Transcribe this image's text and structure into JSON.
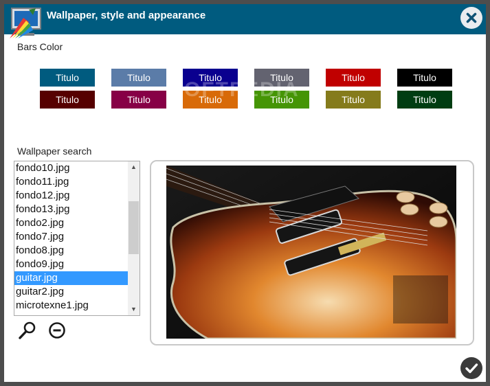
{
  "window": {
    "title": "Wallpaper, style and appearance"
  },
  "bars_color": {
    "label": "Bars Color",
    "swatches": [
      {
        "label": "Titulo",
        "color": "#005b7f"
      },
      {
        "label": "Titulo",
        "color": "#5b7ca8"
      },
      {
        "label": "Titulo",
        "color": "#0a008f"
      },
      {
        "label": "Titulo",
        "color": "#636370"
      },
      {
        "label": "Titulo",
        "color": "#c00000"
      },
      {
        "label": "Titulo",
        "color": "#000000"
      },
      {
        "label": "Titulo",
        "color": "#560000"
      },
      {
        "label": "Titulo",
        "color": "#870046"
      },
      {
        "label": "Titulo",
        "color": "#d86a08"
      },
      {
        "label": "Titulo",
        "color": "#459505"
      },
      {
        "label": "Titulo",
        "color": "#857b1c"
      },
      {
        "label": "Titulo",
        "color": "#003d12"
      }
    ]
  },
  "wallpaper": {
    "label": "Wallpaper search",
    "files": [
      "fondo10.jpg",
      "fondo11.jpg",
      "fondo12.jpg",
      "fondo13.jpg",
      "fondo2.jpg",
      "fondo7.jpg",
      "fondo8.jpg",
      "fondo9.jpg",
      "guitar.jpg",
      "guitar2.jpg",
      "microtexne1.jpg"
    ],
    "selected": "guitar.jpg"
  },
  "watermark": "SOFTPEDIA",
  "icons": {
    "app": "appearance-monitor-icon",
    "close": "close-icon",
    "search": "magnifier-icon",
    "remove": "minus-circle-icon",
    "confirm": "checkmark-icon"
  },
  "colors": {
    "titlebar": "#005b7f",
    "selection": "#3399ff",
    "frame": "#4d4d4d"
  }
}
